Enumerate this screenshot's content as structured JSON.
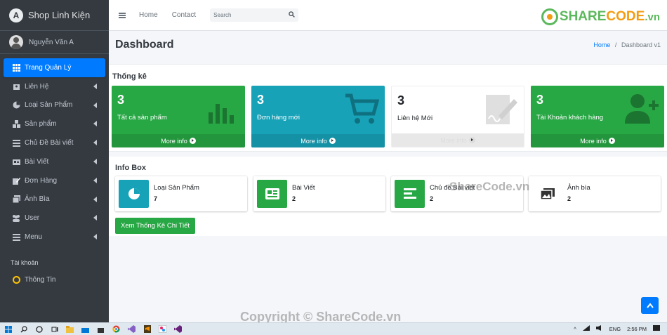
{
  "sidebar": {
    "brand": "Shop Linh Kiện",
    "brand_logo": "A",
    "user": "Nguyễn Văn A",
    "items": [
      {
        "label": "Trang Quản Lý",
        "icon": "grid-icon",
        "active": true
      },
      {
        "label": "Liên Hệ",
        "icon": "contact-card-icon"
      },
      {
        "label": "Loại Sản Phẩm",
        "icon": "pie-chart-icon"
      },
      {
        "label": "Sản phẩm",
        "icon": "boxes-icon"
      },
      {
        "label": "Chủ Đề Bài viết",
        "icon": "list-icon"
      },
      {
        "label": "Bài Viết",
        "icon": "newspaper-icon"
      },
      {
        "label": "Đơn Hàng",
        "icon": "edit-icon"
      },
      {
        "label": "Ảnh Bìa",
        "icon": "images-icon"
      },
      {
        "label": "User",
        "icon": "users-icon"
      },
      {
        "label": "Menu",
        "icon": "bars-icon"
      }
    ],
    "account_header": "Tài khoản",
    "account_item": "Thông Tin"
  },
  "topbar": {
    "home": "Home",
    "contact": "Contact",
    "search_placeholder": "Search",
    "logo_a": "SHARE",
    "logo_b": "CODE",
    "logo_c": ".vn"
  },
  "header": {
    "title": "Dashboard",
    "breadcrumb_home": "Home",
    "breadcrumb_sep": "/",
    "breadcrumb_current": "Dashboard v1"
  },
  "stats": {
    "title": "Thống kê",
    "boxes": [
      {
        "number": "3",
        "label": "Tất cả sản phẩm",
        "more": "More info",
        "color": "#28a745"
      },
      {
        "number": "3",
        "label": "Đơn hàng mới",
        "more": "More info",
        "color": "#17a2b8"
      },
      {
        "number": "3",
        "label": "Liên hệ Mới",
        "more": "More info",
        "color": "#ffffff"
      },
      {
        "number": "3",
        "label": "Tài Khoản khách hàng",
        "more": "More info",
        "color": "#28a745"
      }
    ]
  },
  "infobox": {
    "title": "Info Box",
    "boxes": [
      {
        "label": "Loại Sản Phẩm",
        "value": "7",
        "color": "#17a2b8"
      },
      {
        "label": "Bài Viết",
        "value": "2",
        "color": "#28a745"
      },
      {
        "label": "Chủ đề Bài viết",
        "value": "2",
        "color": "#28a745"
      },
      {
        "label": "Ảnh bìa",
        "value": "2",
        "color": "#ffffff"
      }
    ],
    "button": "Xem Thống Kê Chi Tiết"
  },
  "watermark": "ShareCode.vn",
  "copyright": "Copyright © ShareCode.vn",
  "taskbar": {
    "lang": "ENG",
    "time": "2:56 PM"
  }
}
